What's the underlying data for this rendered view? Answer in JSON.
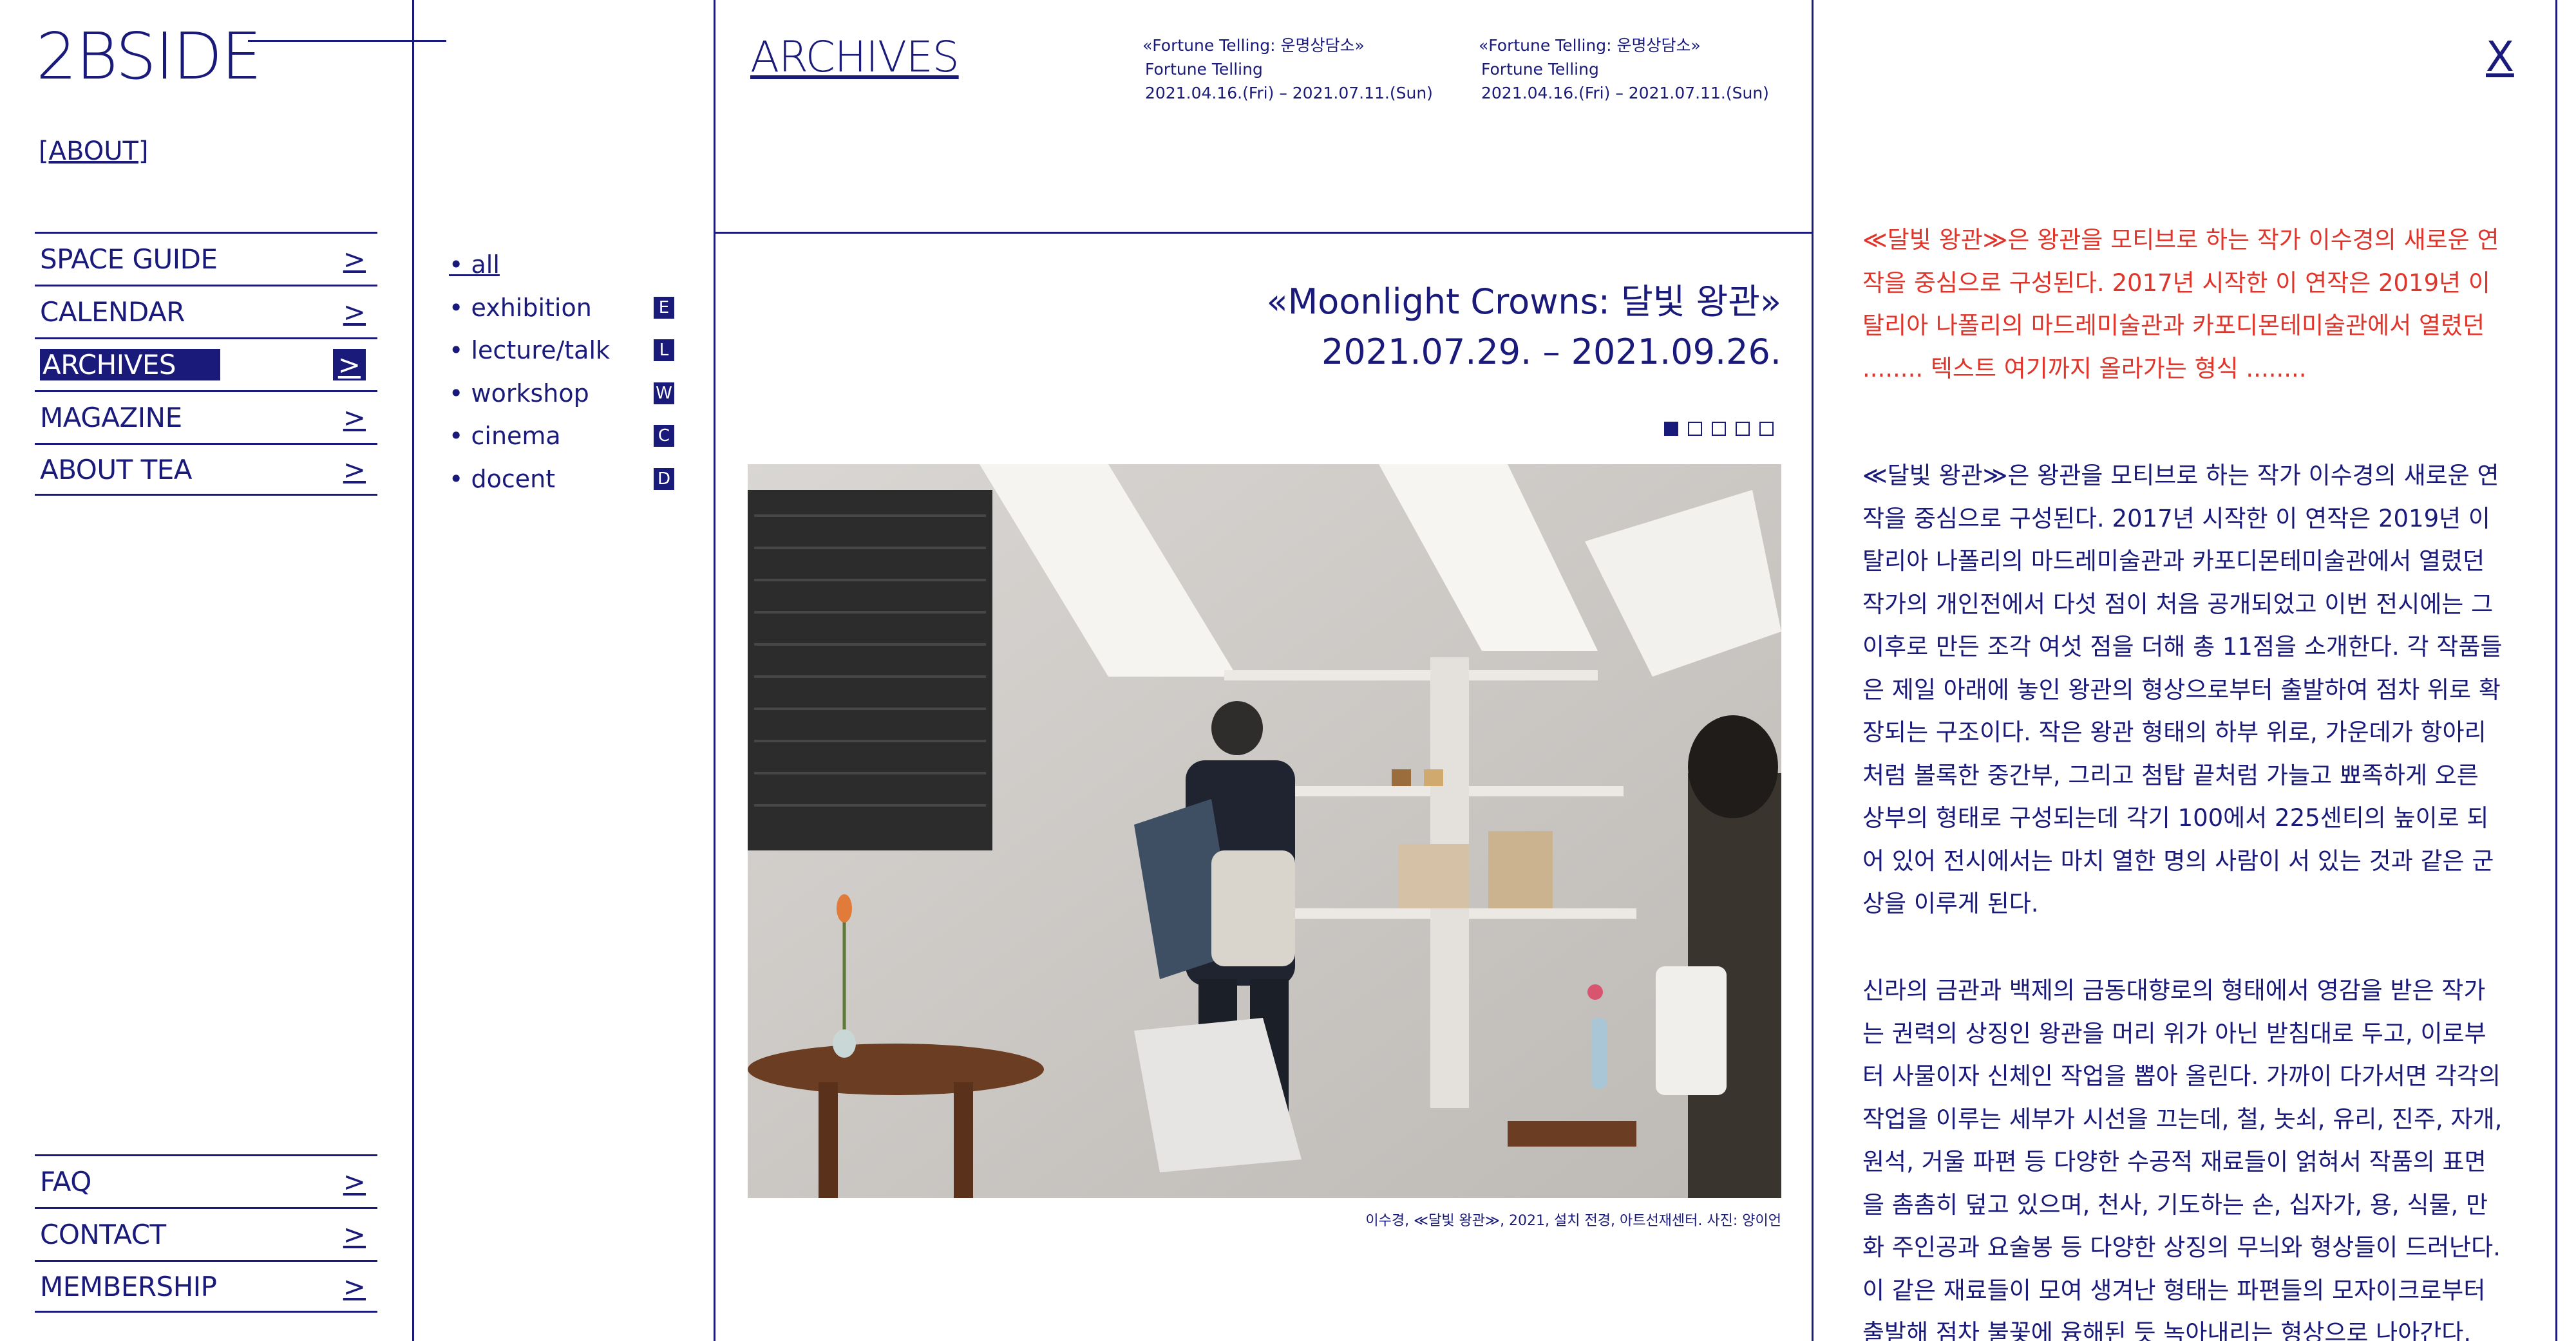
{
  "brand": {
    "logo": "2BSIDE",
    "about_link": "[ABOUT]"
  },
  "sidebar": {
    "menu": [
      {
        "label": "SPACE GUIDE",
        "arrow": ">"
      },
      {
        "label": "CALENDAR",
        "arrow": ">"
      },
      {
        "label": "ARCHIVES",
        "arrow": ">",
        "active": true
      },
      {
        "label": "MAGAZINE",
        "arrow": ">"
      },
      {
        "label": "ABOUT TEA",
        "arrow": ">"
      }
    ],
    "footer_menu": [
      {
        "label": "FAQ",
        "arrow": ">"
      },
      {
        "label": "CONTACT",
        "arrow": ">"
      },
      {
        "label": "MEMBERSHIP",
        "arrow": ">"
      }
    ]
  },
  "filters": [
    {
      "label": "• all",
      "badge": "",
      "active": true
    },
    {
      "label": "• exhibition",
      "badge": "E"
    },
    {
      "label": "• lecture/talk",
      "badge": "L"
    },
    {
      "label": "• workshop",
      "badge": "W"
    },
    {
      "label": "• cinema",
      "badge": "C"
    },
    {
      "label": "• docent",
      "badge": "D"
    }
  ],
  "header": {
    "section_title": "ARCHIVES",
    "schedule": [
      {
        "title": "«Fortune Telling: 운명상담소»",
        "subtitle": "Fortune Telling",
        "dates": "2021.04.16.(Fri) – 2021.07.11.(Sun)"
      },
      {
        "title": "«Fortune Telling: 운명상담소»",
        "subtitle": "Fortune Telling",
        "dates": "2021.04.16.(Fri) – 2021.07.11.(Sun)"
      }
    ],
    "close_label": "X"
  },
  "exhibition": {
    "title": "«Moonlight Crowns: 달빛 왕관»",
    "dates": "2021.07.29. – 2021.09.26.",
    "slides_total": 5,
    "slide_active": 1,
    "caption": "이수경, ≪달빛 왕관≫, 2021, 설치 전경, 아트선재센터. 사진: 양이언"
  },
  "article": {
    "intro": "≪달빛 왕관≫은 왕관을 모티브로 하는 작가 이수경의 새로운 연작을 중심으로 구성된다. 2017년 시작한 이 연작은 2019년 이탈리아 나폴리의 마드레미술관과 카포디몬테미술관에서 열렸던 ........ 텍스트 여기까지 올라가는 형식 ........",
    "para1": "≪달빛 왕관≫은 왕관을 모티브로 하는 작가 이수경의 새로운 연작을 중심으로 구성된다. 2017년 시작한 이 연작은 2019년 이탈리아 나폴리의 마드레미술관과 카포디몬테미술관에서 열렸던 작가의 개인전에서 다섯 점이 처음 공개되었고 이번 전시에는 그 이후로 만든 조각 여섯 점을 더해 총 11점을 소개한다. 각 작품들은 제일 아래에 놓인 왕관의 형상으로부터 출발하여 점차 위로 확장되는 구조이다. 작은 왕관 형태의 하부 위로, 가운데가 항아리처럼 볼록한 중간부, 그리고 첨탑 끝처럼 가늘고 뾰족하게 오른 상부의 형태로 구성되는데 각기 100에서 225센티의 높이로 되어 있어 전시에서는 마치 열한 명의 사람이 서 있는 것과 같은 군상을 이루게 된다.",
    "para2": "신라의 금관과 백제의 금동대향로의 형태에서 영감을 받은 작가는 권력의 상징인 왕관을 머리 위가 아닌 받침대로 두고, 이로부터 사물이자 신체인 작업을 뽑아 올린다. 가까이 다가서면 각각의 작업을 이루는 세부가 시선을 끄는데, 철, 놋쇠, 유리, 진주, 자개, 원석, 거울 파편 등 다양한 수공적 재료들이 얽혀서 작품의 표면을 촘촘히 덮고 있으며, 천사, 기도하는 손, 십자가, 용, 식물, 만화 주인공과 요술봉 등 다양한 상징의 무늬와 형상들이 드러난다. 이 같은 재료들이 모여 생겨난 형태는 파편들의 모자이크로부터 출발해 점차 불꽃에 융해된 듯 녹아내리는 형상으로 나아간다."
  },
  "colors": {
    "primary": "#1a1a7a",
    "accent_red": "#e0352b"
  }
}
